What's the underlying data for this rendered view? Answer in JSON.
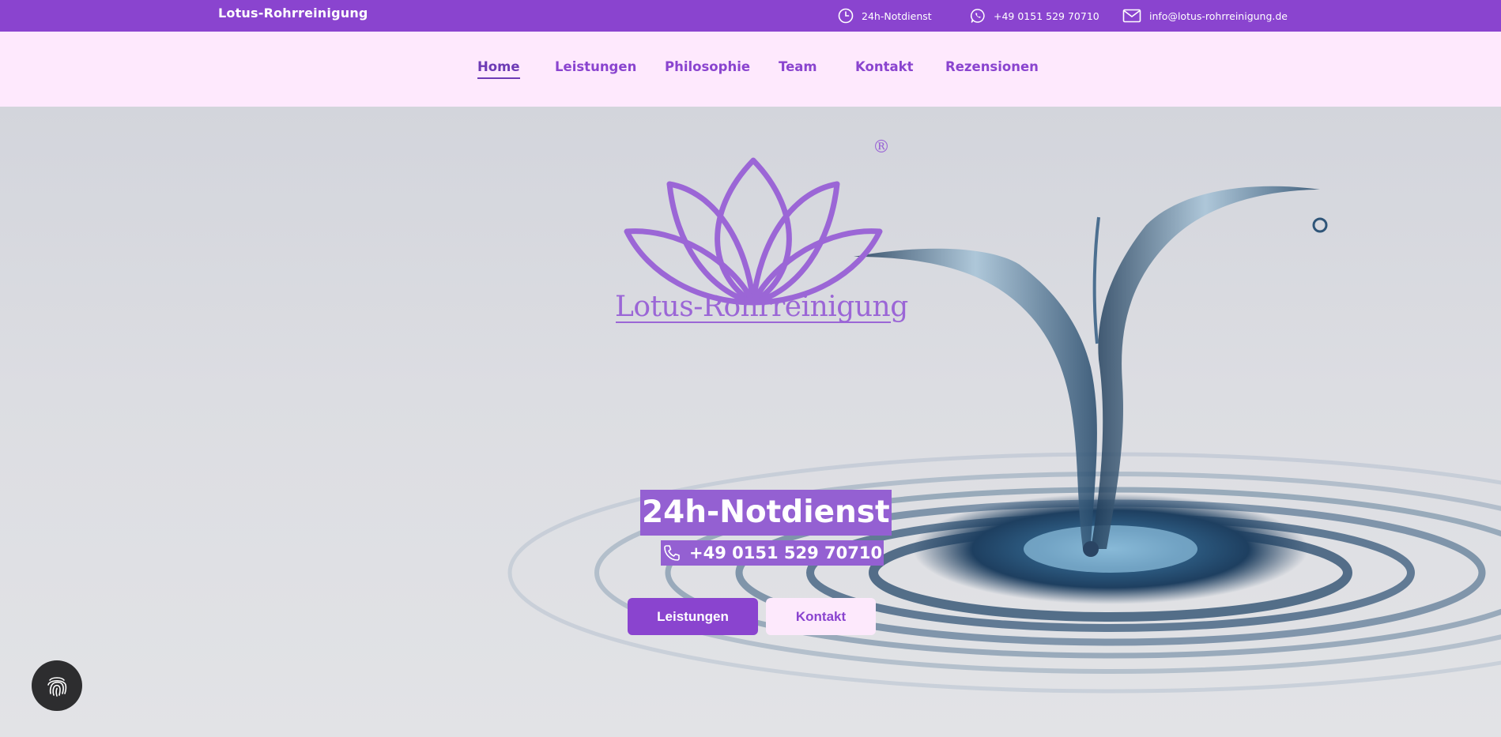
{
  "topbar": {
    "brand": "Lotus-Rohrreinigung",
    "contacts": [
      {
        "icon": "clock-icon",
        "text": "24h-Notdienst"
      },
      {
        "icon": "whatsapp-icon",
        "text": "+49 0151 529 70710"
      },
      {
        "icon": "mail-icon",
        "text": "info@lotus-rohrreinigung.de"
      }
    ]
  },
  "nav": {
    "items": [
      {
        "label": "Home",
        "active": true
      },
      {
        "label": "Leistungen"
      },
      {
        "label": "Philosophie"
      },
      {
        "label": "Team"
      },
      {
        "label": "Kontakt"
      },
      {
        "label": "Rezensionen"
      }
    ]
  },
  "hero": {
    "logo_text": "Lotus-Rohrreinigung",
    "registered_mark": "®",
    "headline": "24h-Notdienst",
    "phone": "+49 0151 529 70710",
    "buttons": {
      "primary": "Leistungen",
      "secondary": "Kontakt"
    }
  },
  "widgets": {
    "fingerprint": "fingerprint-icon"
  },
  "colors": {
    "brand_purple": "#8a44cf",
    "nav_bg": "#fee9fd",
    "highlight": "#9460d2",
    "logo": "#9b66d6"
  }
}
